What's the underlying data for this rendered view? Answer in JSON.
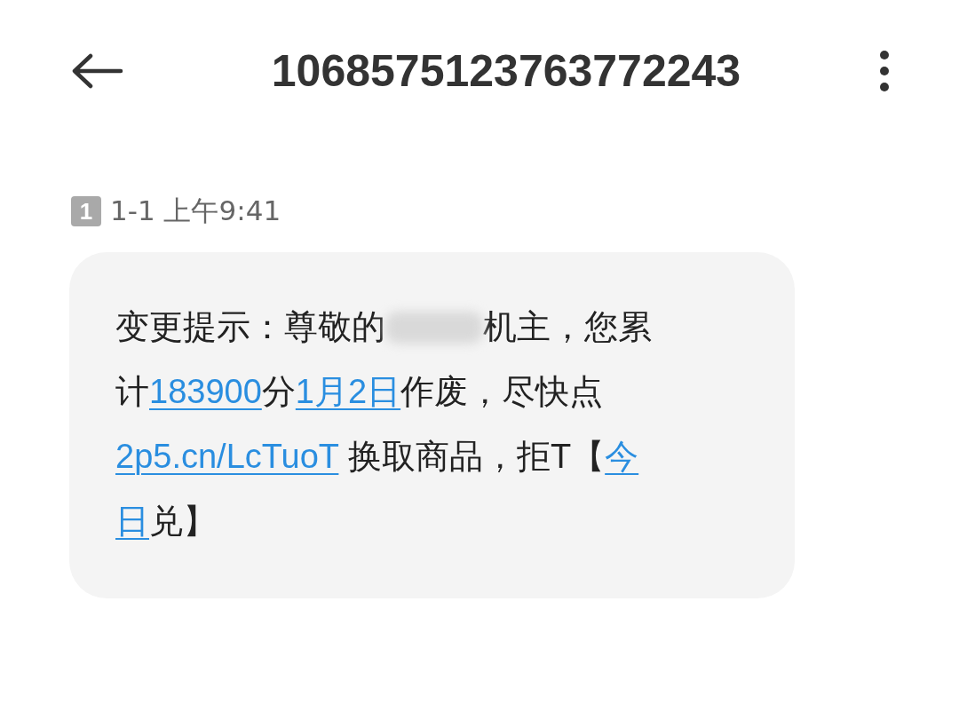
{
  "header": {
    "title": "1068575123763772243"
  },
  "messages": [
    {
      "sim_slot": "1",
      "timestamp": "1-1 上午9:41",
      "segments": [
        {
          "kind": "text",
          "text": "变更提示：尊敬的"
        },
        {
          "kind": "redacted"
        },
        {
          "kind": "text",
          "text": "机主，您累计"
        },
        {
          "kind": "link",
          "text": "183900"
        },
        {
          "kind": "text",
          "text": "分"
        },
        {
          "kind": "link",
          "text": "1月2日"
        },
        {
          "kind": "text",
          "text": "作废，尽快点"
        },
        {
          "kind": "link",
          "text": "2p5.cn/LcTuoT"
        },
        {
          "kind": "text",
          "text": " 换取商品，拒T【"
        },
        {
          "kind": "link",
          "text": "今"
        },
        {
          "kind": "link",
          "text": "日"
        },
        {
          "kind": "text",
          "text": "兑】"
        }
      ]
    }
  ]
}
